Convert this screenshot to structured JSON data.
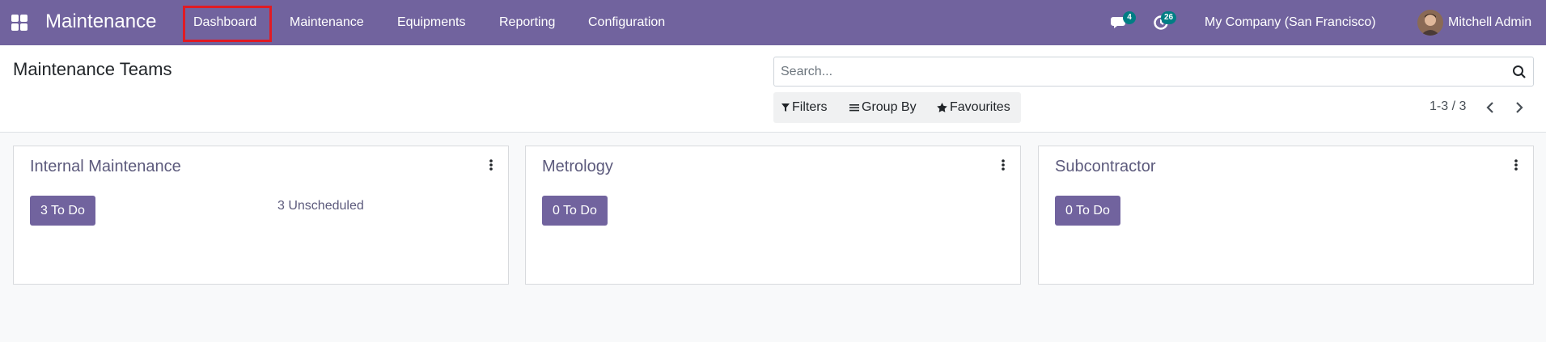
{
  "navbar": {
    "app_title": "Maintenance",
    "menu": [
      "Dashboard",
      "Maintenance",
      "Equipments",
      "Reporting",
      "Configuration"
    ],
    "active_menu": "Dashboard",
    "chat_count": "4",
    "activity_count": "26",
    "company": "My Company (San Francisco)",
    "user": "Mitchell Admin"
  },
  "control_panel": {
    "title": "Maintenance Teams",
    "search_placeholder": "Search...",
    "filters_label": "Filters",
    "group_by_label": "Group By",
    "favourites_label": "Favourites",
    "pager": "1-3 / 3"
  },
  "teams": [
    {
      "name": "Internal Maintenance",
      "todo_label": "3 To Do",
      "unscheduled_label": "3 Unscheduled"
    },
    {
      "name": "Metrology",
      "todo_label": "0 To Do"
    },
    {
      "name": "Subcontractor",
      "todo_label": "0 To Do"
    }
  ],
  "colors": {
    "brand": "#71639e",
    "highlight_box": "#e01b24",
    "badge": "#017e84"
  }
}
